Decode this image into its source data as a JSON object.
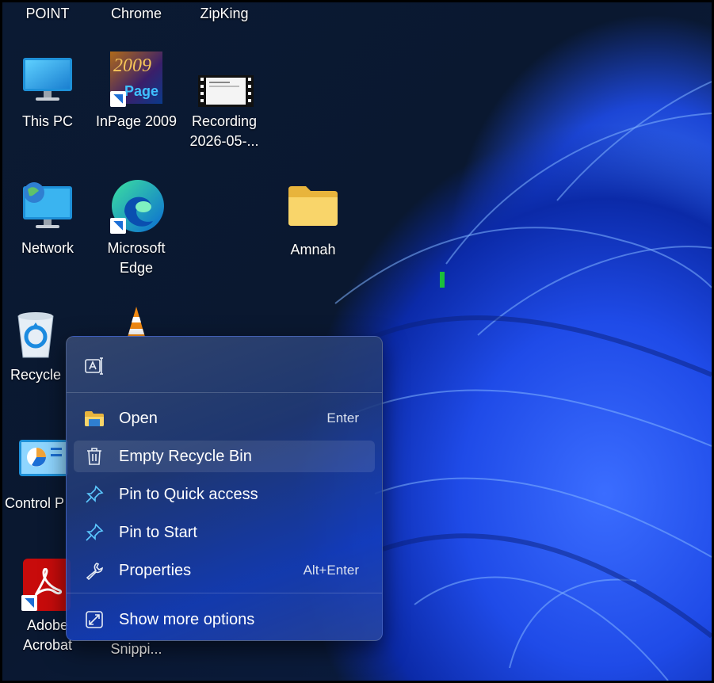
{
  "desktop": {
    "top_row": [
      "POINT",
      "Chrome",
      "ZipKing"
    ],
    "icons": [
      {
        "label": "This PC"
      },
      {
        "label": "InPage 2009"
      },
      {
        "label": "Recording 2026-05-..."
      },
      {
        "label": "Network"
      },
      {
        "label": "Microsoft Edge"
      },
      {
        "label": "Amnah"
      },
      {
        "label": "Recycle"
      },
      {
        "label": "Control P"
      },
      {
        "label": "Adobe Acrobat"
      },
      {
        "label": "Snippi..."
      }
    ],
    "inpage_art_text": "2009",
    "inpage_art_text2": "Page"
  },
  "context_menu": {
    "items": [
      {
        "label": "Open",
        "shortcut": "Enter",
        "icon": "folder-icon"
      },
      {
        "label": "Empty Recycle Bin",
        "shortcut": "",
        "icon": "trash-icon"
      },
      {
        "label": "Pin to Quick access",
        "shortcut": "",
        "icon": "pin-icon"
      },
      {
        "label": "Pin to Start",
        "shortcut": "",
        "icon": "pin-icon"
      },
      {
        "label": "Properties",
        "shortcut": "Alt+Enter",
        "icon": "wrench-icon"
      }
    ],
    "more": {
      "label": "Show more options",
      "icon": "expand-icon"
    },
    "hovered_index": 1
  },
  "colors": {
    "accent": "#4cc2ff",
    "menu_hover": "rgba(255,255,255,0.1)"
  }
}
